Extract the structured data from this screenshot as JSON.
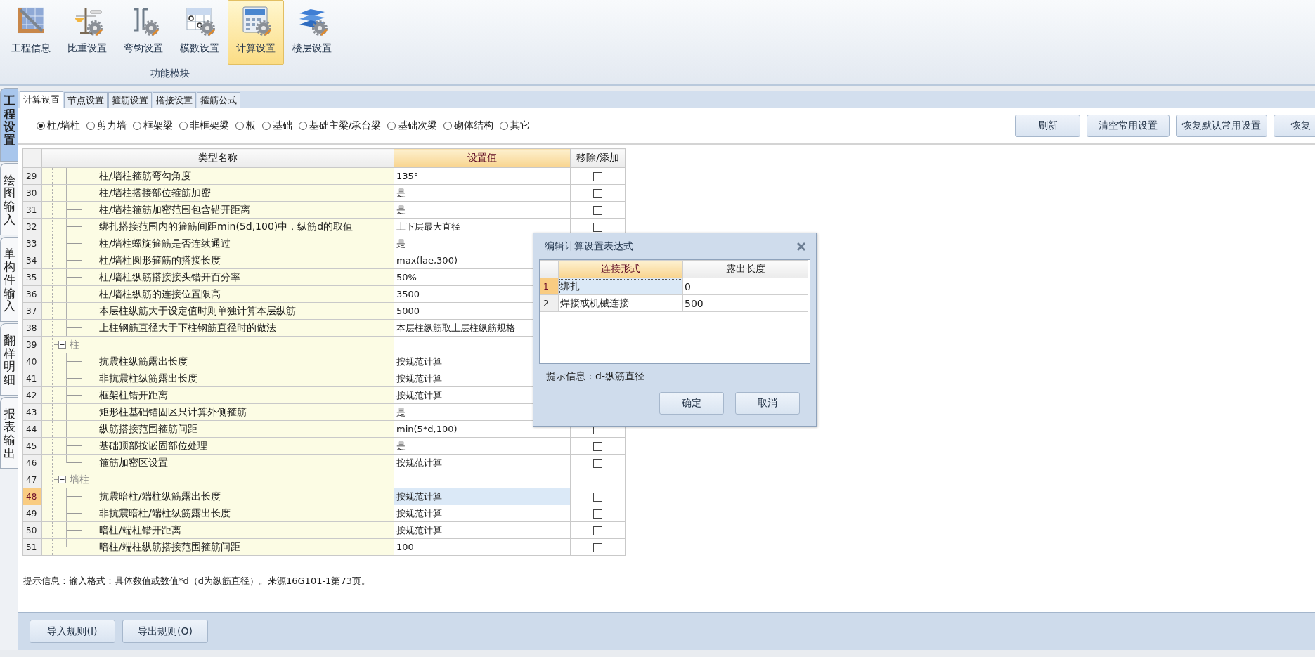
{
  "ribbon": {
    "tools": [
      {
        "label": "工程信息",
        "selected": false
      },
      {
        "label": "比重设置",
        "selected": false
      },
      {
        "label": "弯钩设置",
        "selected": false
      },
      {
        "label": "模数设置",
        "selected": false
      },
      {
        "label": "计算设置",
        "selected": true
      },
      {
        "label": "楼层设置",
        "selected": false
      }
    ],
    "group_label": "功能模块"
  },
  "side_tabs": [
    {
      "label": "工程设置",
      "selected": true
    },
    {
      "label": "绘图输入",
      "selected": false
    },
    {
      "label": "单构件输入",
      "selected": false
    },
    {
      "label": "翻样明细",
      "selected": false
    },
    {
      "label": "报表输出",
      "selected": false
    }
  ],
  "sub_tabs": [
    {
      "label": "计算设置",
      "selected": true
    },
    {
      "label": "节点设置",
      "selected": false
    },
    {
      "label": "箍筋设置",
      "selected": false
    },
    {
      "label": "搭接设置",
      "selected": false
    },
    {
      "label": "箍筋公式",
      "selected": false
    }
  ],
  "component_types": [
    {
      "label": "柱/墙柱",
      "selected": true
    },
    {
      "label": "剪力墙",
      "selected": false
    },
    {
      "label": "框架梁",
      "selected": false
    },
    {
      "label": "非框架梁",
      "selected": false
    },
    {
      "label": "板",
      "selected": false
    },
    {
      "label": "基础",
      "selected": false
    },
    {
      "label": "基础主梁/承台梁",
      "selected": false
    },
    {
      "label": "基础次梁",
      "selected": false
    },
    {
      "label": "砌体结构",
      "selected": false
    },
    {
      "label": "其它",
      "selected": false
    }
  ],
  "actions": [
    "刷新",
    "清空常用设置",
    "恢复默认常用设置",
    "恢复"
  ],
  "table": {
    "columns": [
      {
        "label": "类型名称",
        "selected": false
      },
      {
        "label": "设置值",
        "selected": true
      },
      {
        "label": "移除/添加",
        "selected": false
      }
    ],
    "rows": [
      {
        "kind": "item",
        "num": "29",
        "name": "柱/墙柱箍筋弯勾角度",
        "value": "135°",
        "selected": false,
        "checked": false
      },
      {
        "kind": "item",
        "num": "30",
        "name": "柱/墙柱搭接部位箍筋加密",
        "value": "是",
        "selected": false,
        "checked": false
      },
      {
        "kind": "item",
        "num": "31",
        "name": "柱/墙柱箍筋加密范围包含错开距离",
        "value": "是",
        "selected": false,
        "checked": false
      },
      {
        "kind": "item",
        "num": "32",
        "name": "绑扎搭接范围内的箍筋间距min(5d,100)中，纵筋d的取值",
        "value": "上下层最大直径",
        "selected": false,
        "checked": false
      },
      {
        "kind": "item",
        "num": "33",
        "name": "柱/墙柱螺旋箍筋是否连续通过",
        "value": "是",
        "selected": false
      },
      {
        "kind": "item",
        "num": "34",
        "name": "柱/墙柱圆形箍筋的搭接长度",
        "value": "max(lae,300)",
        "selected": false
      },
      {
        "kind": "item",
        "num": "35",
        "name": "柱/墙柱纵筋搭接接头错开百分率",
        "value": "50%",
        "selected": false
      },
      {
        "kind": "item",
        "num": "36",
        "name": "柱/墙柱纵筋的连接位置限高",
        "value": "3500",
        "selected": false
      },
      {
        "kind": "item",
        "num": "37",
        "name": "本层柱纵筋大于设定值时则单独计算本层纵筋",
        "value": "5000",
        "selected": false
      },
      {
        "kind": "item",
        "num": "38",
        "name": "上柱钢筋直径大于下柱钢筋直径时的做法",
        "value": "本层柱纵筋取上层柱纵筋规格",
        "selected": false
      },
      {
        "kind": "group",
        "num": "39",
        "name": "柱",
        "expanded": true,
        "selected": false,
        "children": [
          {
            "kind": "item",
            "num": "40",
            "name": "抗震柱纵筋露出长度",
            "value": "按规范计算",
            "selected": false
          },
          {
            "kind": "item",
            "num": "41",
            "name": "非抗震柱纵筋露出长度",
            "value": "按规范计算",
            "selected": false
          },
          {
            "kind": "item",
            "num": "42",
            "name": "框架柱错开距离",
            "value": "按规范计算",
            "selected": false
          },
          {
            "kind": "item",
            "num": "43",
            "name": "矩形柱基础锚固区只计算外侧箍筋",
            "value": "是",
            "selected": false
          },
          {
            "kind": "item",
            "num": "44",
            "name": "纵筋搭接范围箍筋间距",
            "value": "min(5*d,100)",
            "selected": false,
            "checked": false
          },
          {
            "kind": "item",
            "num": "45",
            "name": "基础顶部按嵌固部位处理",
            "value": "是",
            "selected": false,
            "checked": false
          },
          {
            "kind": "item",
            "num": "46",
            "name": "箍筋加密区设置",
            "value": "按规范计算",
            "selected": false,
            "checked": false
          }
        ]
      },
      {
        "kind": "group",
        "num": "47",
        "name": "墙柱",
        "expanded": true,
        "selected": false,
        "children": [
          {
            "kind": "item",
            "num": "48",
            "name": "抗震暗柱/端柱纵筋露出长度",
            "value": "按规范计算",
            "selected": true,
            "checked": false
          },
          {
            "kind": "item",
            "num": "49",
            "name": "非抗震暗柱/端柱纵筋露出长度",
            "value": "按规范计算",
            "selected": false,
            "checked": false
          },
          {
            "kind": "item",
            "num": "50",
            "name": "暗柱/端柱错开距离",
            "value": "按规范计算",
            "selected": false,
            "checked": false
          },
          {
            "kind": "item",
            "num": "51",
            "name": "暗柱/端柱纵筋搭接范围箍筋间距",
            "value": "100",
            "selected": false,
            "checked": false
          }
        ]
      }
    ]
  },
  "hint": "提示信息：输入格式：具体数值或数值*d（d为纵筋直径）。来源16G101-1第73页。",
  "footer_buttons": [
    "导入规则(I)",
    "导出规则(O)"
  ],
  "dialog": {
    "title": "编辑计算设置表达式",
    "columns": [
      {
        "label": "连接形式",
        "selected": true
      },
      {
        "label": "露出长度",
        "selected": false
      }
    ],
    "rows": [
      {
        "num": "1",
        "form": "绑扎",
        "length": "0",
        "selected": true
      },
      {
        "num": "2",
        "form": "焊接或机械连接",
        "length": "500",
        "selected": false
      }
    ],
    "hint": "提示信息：d-纵筋直径",
    "buttons": [
      "确定",
      "取消"
    ]
  }
}
